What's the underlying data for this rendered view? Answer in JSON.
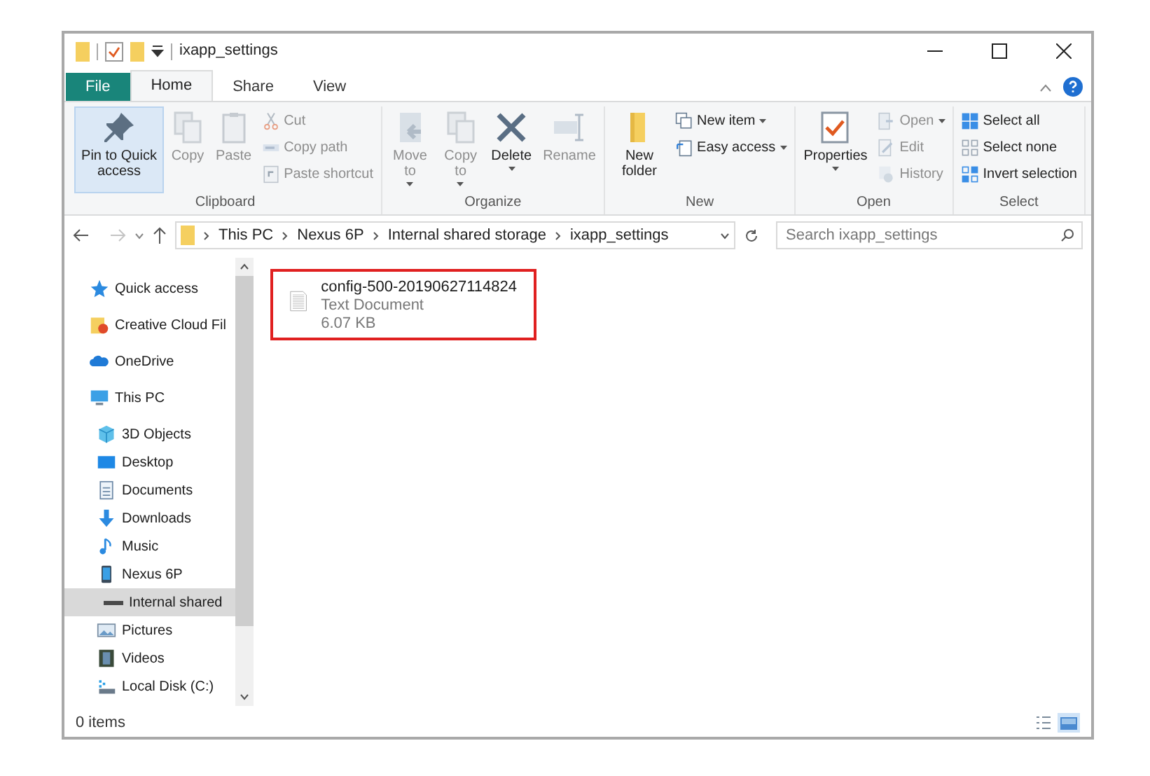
{
  "window": {
    "title": "ixapp_settings"
  },
  "tabs": [
    {
      "label": "File",
      "kind": "file",
      "selected": false
    },
    {
      "label": "Home",
      "kind": "tab",
      "selected": true
    },
    {
      "label": "Share",
      "kind": "tab",
      "selected": false
    },
    {
      "label": "View",
      "kind": "tab",
      "selected": false
    }
  ],
  "ribbon": [
    {
      "label": "Clipboard",
      "items": [
        {
          "kind": "pin",
          "label": "Pin to Quick access",
          "disabled": false,
          "highlighted": true,
          "dropdown": false
        },
        {
          "kind": "copy",
          "label": "Copy",
          "disabled": true,
          "highlighted": false,
          "dropdown": false
        },
        {
          "kind": "paste",
          "label": "Paste",
          "disabled": true,
          "highlighted": false,
          "dropdown": false
        },
        {
          "kind": "cut",
          "label": "Cut",
          "disabled": true,
          "highlighted": false,
          "dropdown": false
        },
        {
          "kind": "path",
          "label": "Copy path",
          "disabled": true,
          "highlighted": false,
          "dropdown": false
        },
        {
          "kind": "shortcut",
          "label": "Paste shortcut",
          "disabled": true,
          "highlighted": false,
          "dropdown": false
        }
      ]
    },
    {
      "label": "Organize",
      "items": [
        {
          "kind": "move",
          "label": "Move to",
          "disabled": true,
          "highlighted": false,
          "dropdown": true
        },
        {
          "kind": "copyto",
          "label": "Copy to",
          "disabled": true,
          "highlighted": false,
          "dropdown": true
        },
        {
          "kind": "delete",
          "label": "Delete",
          "disabled": false,
          "highlighted": false,
          "dropdown": true
        },
        {
          "kind": "rename",
          "label": "Rename",
          "disabled": true,
          "highlighted": false,
          "dropdown": false
        }
      ]
    },
    {
      "label": "New",
      "items": [
        {
          "kind": "folder",
          "label": "New folder",
          "disabled": false,
          "highlighted": false,
          "dropdown": false
        },
        {
          "kind": "newitem",
          "label": "New item",
          "disabled": false,
          "highlighted": false,
          "dropdown": true
        },
        {
          "kind": "easy",
          "label": "Easy access",
          "disabled": false,
          "highlighted": false,
          "dropdown": true
        }
      ]
    },
    {
      "label": "Open",
      "items": [
        {
          "kind": "properties",
          "label": "Properties",
          "disabled": false,
          "highlighted": false,
          "dropdown": true
        },
        {
          "kind": "open",
          "label": "Open",
          "disabled": true,
          "highlighted": false,
          "dropdown": true
        },
        {
          "kind": "edit",
          "label": "Edit",
          "disabled": true,
          "highlighted": false,
          "dropdown": false
        },
        {
          "kind": "history",
          "label": "History",
          "disabled": true,
          "highlighted": false,
          "dropdown": false
        }
      ]
    },
    {
      "label": "Select",
      "items": [
        {
          "kind": "selectall",
          "label": "Select all",
          "disabled": false,
          "highlighted": false,
          "dropdown": false
        },
        {
          "kind": "selectnone",
          "label": "Select none",
          "disabled": false,
          "highlighted": false,
          "dropdown": false
        },
        {
          "kind": "invert",
          "label": "Invert selection",
          "disabled": false,
          "highlighted": false,
          "dropdown": false
        }
      ]
    }
  ],
  "address": {
    "path": [
      "This PC",
      "Nexus 6P",
      "Internal shared storage",
      "ixapp_settings"
    ]
  },
  "search": {
    "placeholder": "Search ixapp_settings"
  },
  "navigation": [
    {
      "label": "Quick access",
      "kind": "star",
      "selected": false
    },
    {
      "label": "Creative Cloud Fil",
      "kind": "cc",
      "selected": false
    },
    {
      "label": "OneDrive",
      "kind": "cloud",
      "selected": false
    },
    {
      "label": "This PC",
      "kind": "pc",
      "selected": false,
      "children": [
        {
          "label": "3D Objects",
          "kind": "cube",
          "selected": false
        },
        {
          "label": "Desktop",
          "kind": "desktop",
          "selected": false
        },
        {
          "label": "Documents",
          "kind": "doc",
          "selected": false
        },
        {
          "label": "Downloads",
          "kind": "download",
          "selected": false
        },
        {
          "label": "Music",
          "kind": "music",
          "selected": false
        },
        {
          "label": "Nexus 6P",
          "kind": "phone",
          "selected": false,
          "children": [
            {
              "label": "Internal shared",
              "kind": "drive",
              "selected": true
            }
          ]
        },
        {
          "label": "Pictures",
          "kind": "pictures",
          "selected": false
        },
        {
          "label": "Videos",
          "kind": "videos",
          "selected": false
        },
        {
          "label": "Local Disk (C:)",
          "kind": "disk",
          "selected": false
        }
      ]
    }
  ],
  "files": [
    {
      "name": "config-500-20190627114824",
      "type": "Text Document",
      "size": "6.07 KB",
      "outlined": true
    }
  ],
  "status_bar": {
    "text": "0 items",
    "views": [
      {
        "kind": "details",
        "selected": false
      },
      {
        "kind": "large-icons",
        "selected": true
      }
    ]
  }
}
